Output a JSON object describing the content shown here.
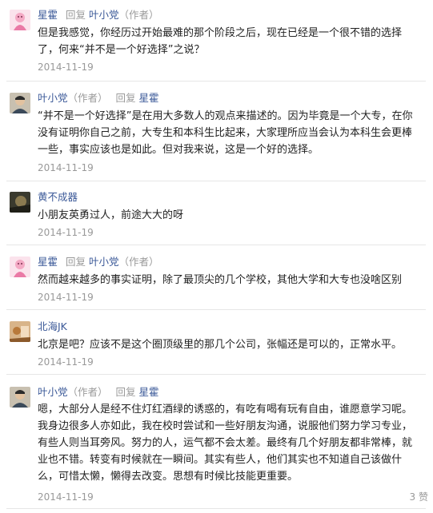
{
  "comments": [
    {
      "author": "星霍",
      "reply_label": "回复",
      "reply_to": "叶小党",
      "reply_to_tag": "（作者）",
      "author_tag": "",
      "text": "但是我感觉，你经历过开始最难的那个阶段之后，现在已经是一个很不错的选择了，何来“并不是一个好选择”之说？",
      "date": "2014-11-19",
      "avatar_icon": "pink-character-avatar-icon"
    },
    {
      "author": "叶小党",
      "author_tag": "（作者）",
      "reply_label": "回复",
      "reply_to": "星霍",
      "reply_to_tag": "",
      "text": "“并不是一个好选择”是在用大多数人的观点来描述的。因为毕竟是一个大专，在你没有证明你自己之前，大专生和本科生比起来，大家理所应当会认为本科生会更棒一些，事实应该也是如此。但对我来说，这是一个好的选择。",
      "date": "2014-11-19",
      "avatar_icon": "person-photo-avatar-icon"
    },
    {
      "author": "黄不成器",
      "author_tag": "",
      "reply_label": "",
      "reply_to": "",
      "reply_to_tag": "",
      "text": "小朋友英勇过人，前途大大的呀",
      "date": "2014-11-19",
      "avatar_icon": "dark-photo-avatar-icon"
    },
    {
      "author": "星霍",
      "author_tag": "",
      "reply_label": "回复",
      "reply_to": "叶小党",
      "reply_to_tag": "（作者）",
      "text": "然而越来越多的事实证明，除了最顶尖的几个学校，其他大学和大专也没啥区别",
      "date": "2014-11-19",
      "avatar_icon": "pink-character-avatar-icon"
    },
    {
      "author": "北海JK",
      "author_tag": "",
      "reply_label": "",
      "reply_to": "",
      "reply_to_tag": "",
      "text": "北京是吧？应该不是这个圈顶级里的那几个公司，张幅还是可以的，正常水平。",
      "date": "2014-11-19",
      "avatar_icon": "orange-photo-avatar-icon"
    },
    {
      "author": "叶小党",
      "author_tag": "（作者）",
      "reply_label": "回复",
      "reply_to": "星霍",
      "reply_to_tag": "",
      "text": "嗯，大部分人是经不住灯红酒绿的诱惑的，有吃有喝有玩有自由，谁愿意学习呢。我身边很多人亦如此，我在校时尝试和一些好朋友沟通，说服他们努力学习专业，有些人则当耳旁风。努力的人，运气都不会太差。最终有几个好朋友都非常棒，就业也不错。转变有时候就在一瞬间。其实有些人，他们其实也不知道自己该做什么，可惜太懒，懒得去改变。思想有时候比技能更重要。",
      "date": "2014-11-19",
      "likes": "3 赞",
      "avatar_icon": "person-photo-avatar-icon"
    }
  ],
  "colors": {
    "link": "#3b5998",
    "muted": "#9a9a9a",
    "divider": "#e6e6e6"
  }
}
